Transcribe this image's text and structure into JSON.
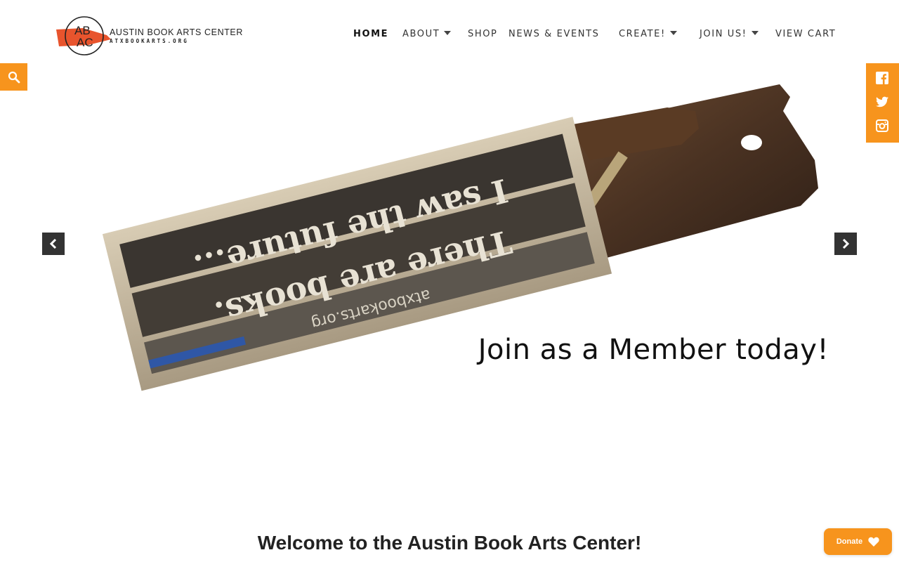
{
  "site": {
    "logo_monogram_top": "AB",
    "logo_monogram_bottom": "AC",
    "name": "AUSTIN BOOK ARTS CENTER",
    "url": "ATXBOOKARTS.ORG"
  },
  "nav": {
    "items": [
      {
        "label": "HOME",
        "active": true,
        "has_dropdown": false
      },
      {
        "label": "ABOUT",
        "active": false,
        "has_dropdown": true
      },
      {
        "label": "SHOP",
        "active": false,
        "has_dropdown": false
      },
      {
        "label": "NEWS & EVENTS",
        "active": false,
        "has_dropdown": false
      },
      {
        "label": "CREATE!",
        "active": false,
        "has_dropdown": true
      },
      {
        "label": "JOIN US!",
        "active": false,
        "has_dropdown": true
      },
      {
        "label": "VIEW CART",
        "active": false,
        "has_dropdown": false
      }
    ]
  },
  "search": {
    "icon": "search-icon"
  },
  "social": {
    "icons": [
      "facebook-icon",
      "twitter-icon",
      "instagram-icon"
    ]
  },
  "slider": {
    "caption": "Join as a Member today!",
    "image_text_line1": "I saw the future...",
    "image_text_line2": "There are books.",
    "image_text_line3": "atxbookarts.org",
    "prev_icon": "chevron-left-icon",
    "next_icon": "chevron-right-icon"
  },
  "main": {
    "heading": "Welcome to the Austin Book Arts Center!"
  },
  "donate": {
    "label": "Donate",
    "icon": "heart-icon"
  },
  "colors": {
    "accent": "#f7941d",
    "logo_red": "#e8542d",
    "dark": "#333333"
  }
}
